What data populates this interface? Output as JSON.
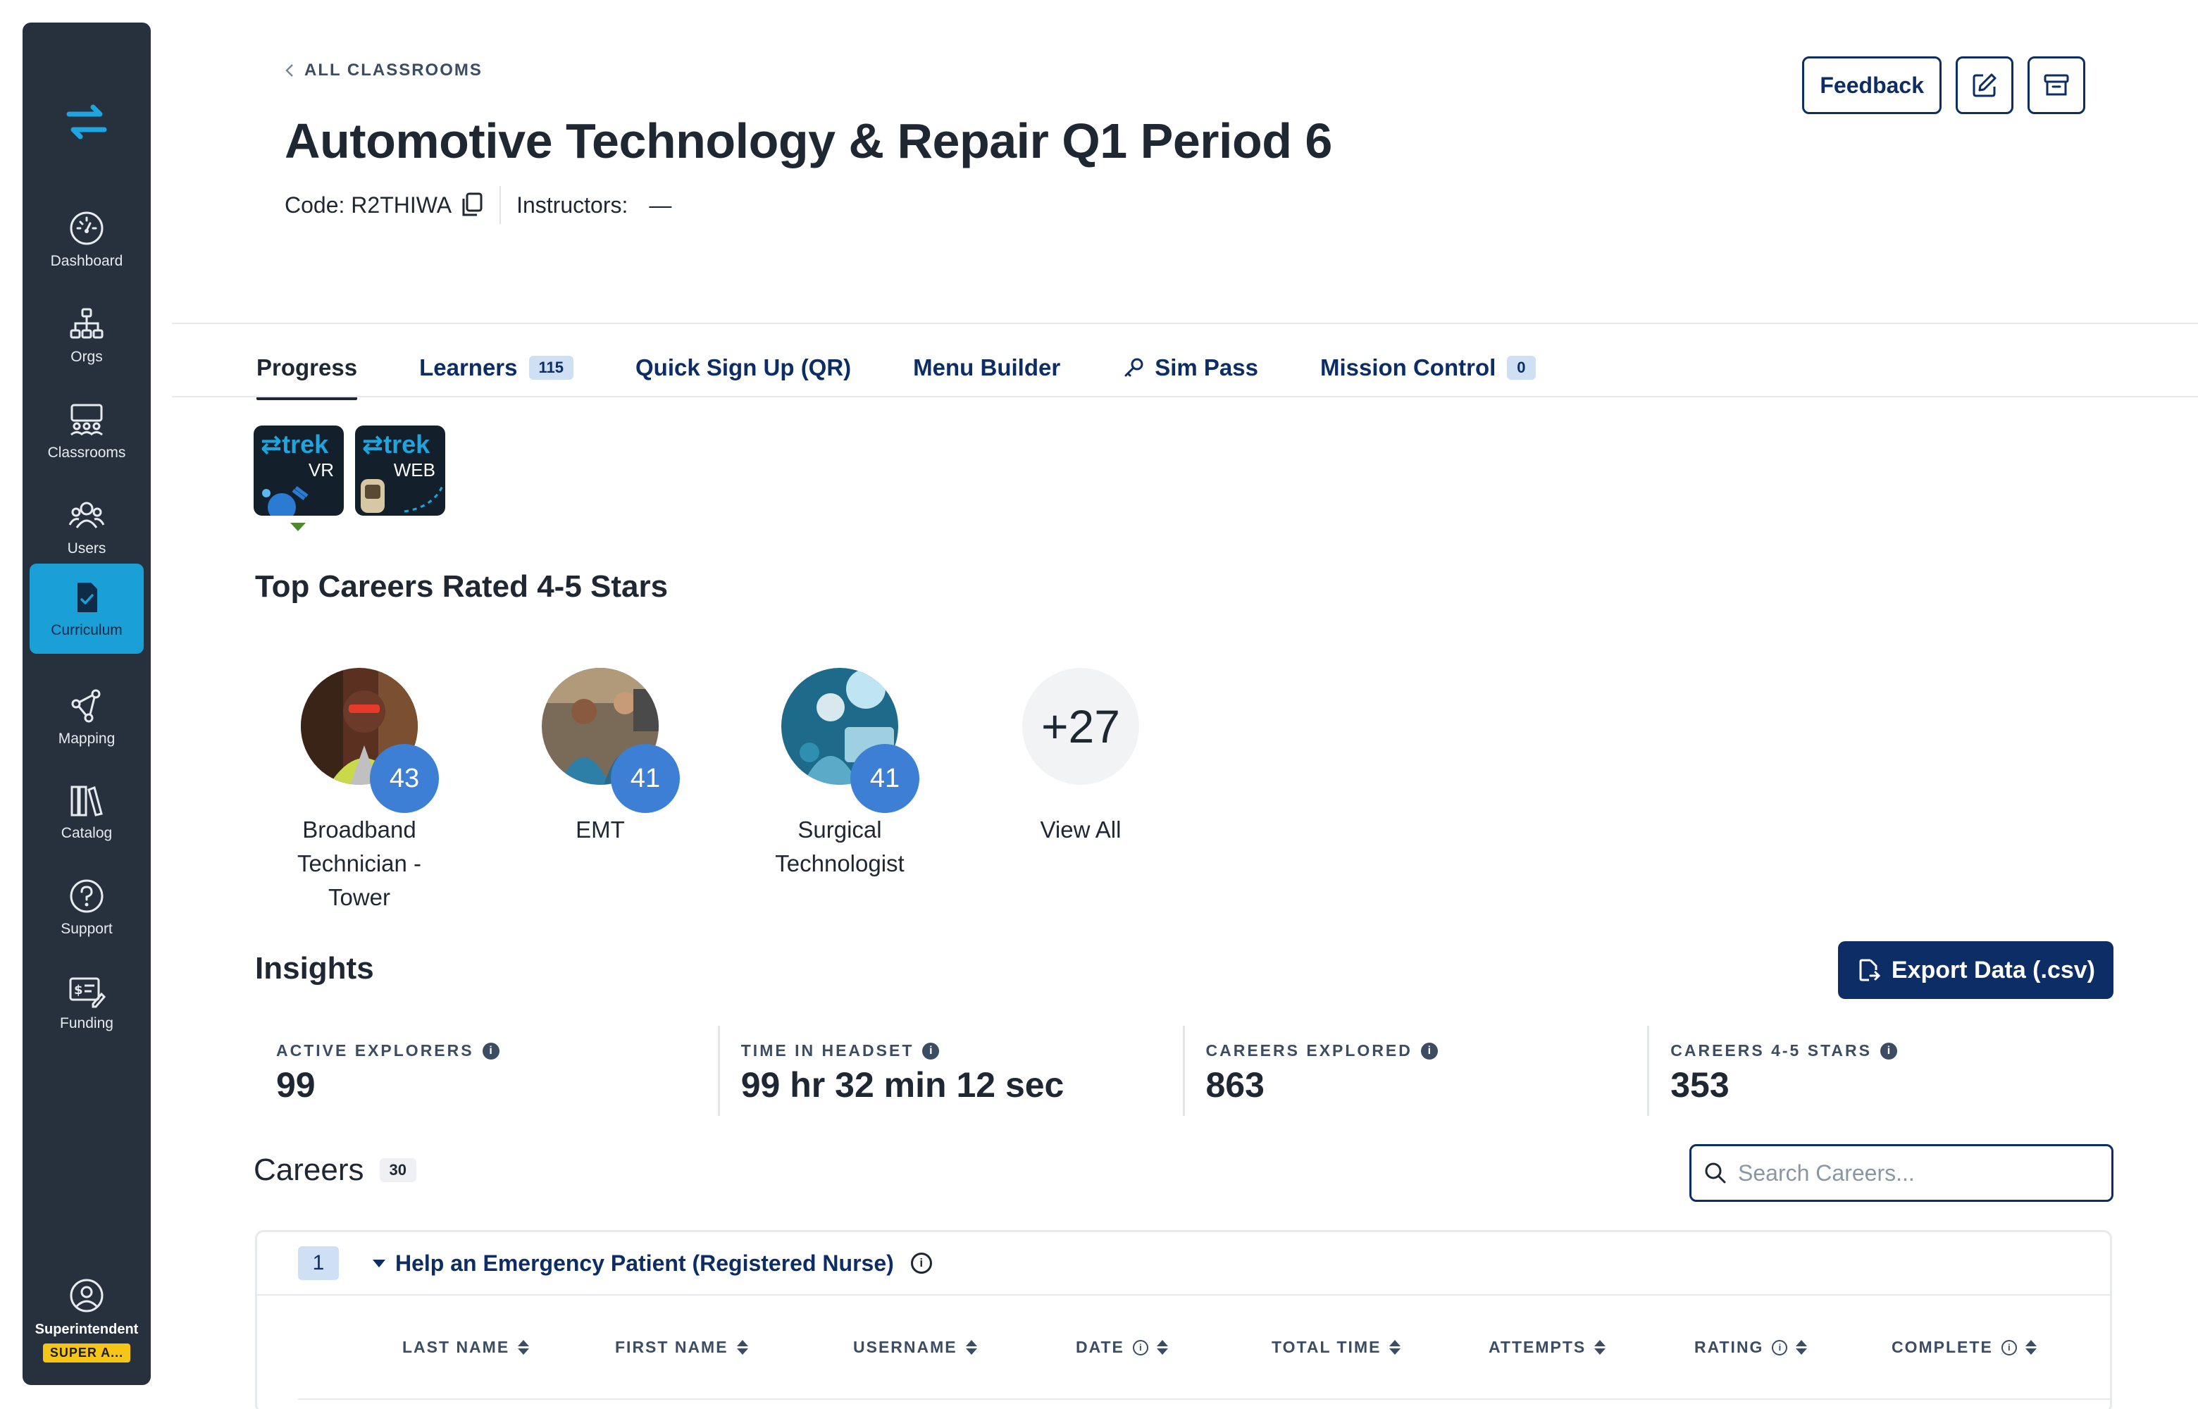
{
  "sidebar": {
    "items": [
      {
        "label": "Dashboard",
        "icon": "dashboard-gauge-icon"
      },
      {
        "label": "Orgs",
        "icon": "org-chart-icon"
      },
      {
        "label": "Classrooms",
        "icon": "classroom-icon"
      },
      {
        "label": "Users",
        "icon": "users-icon"
      },
      {
        "label": "Curriculum",
        "icon": "curriculum-document-icon",
        "active": true
      },
      {
        "label": "Mapping",
        "icon": "mapping-nodes-icon"
      },
      {
        "label": "Catalog",
        "icon": "catalog-books-icon"
      },
      {
        "label": "Support",
        "icon": "question-icon"
      },
      {
        "label": "Funding",
        "icon": "funding-icon"
      }
    ],
    "profile": {
      "label": "Superintendent",
      "badge": "SUPER A..."
    }
  },
  "header": {
    "back_label": "ALL CLASSROOMS",
    "title": "Automotive Technology & Repair Q1 Period 6",
    "code": "Code: R2THIWA",
    "instructors": "Instructors:",
    "instructors_value": "—",
    "feedback_label": "Feedback"
  },
  "tabs": [
    {
      "label": "Progress",
      "active": true
    },
    {
      "label": "Learners",
      "badge": "115"
    },
    {
      "label": "Quick Sign Up (QR)"
    },
    {
      "label": "Menu Builder"
    },
    {
      "label": "Sim Pass",
      "icon": "key-icon"
    },
    {
      "label": "Mission Control",
      "badge": "0"
    }
  ],
  "platforms": [
    {
      "brand": "⇄trek",
      "sub": "VR"
    },
    {
      "brand": "⇄trek",
      "sub": "WEB"
    }
  ],
  "top_careers": {
    "title": "Top Careers Rated 4-5 Stars",
    "items": [
      {
        "name": "Broadband Technician - Tower",
        "count": "43"
      },
      {
        "name": "EMT",
        "count": "41"
      },
      {
        "name": "Surgical Technologist",
        "count": "41"
      }
    ],
    "more": {
      "count": "+27",
      "label": "View All"
    }
  },
  "insights": {
    "title": "Insights",
    "export_label": "Export Data (.csv)",
    "stats": [
      {
        "label": "ACTIVE EXPLORERS",
        "value": "99"
      },
      {
        "label": "TIME IN HEADSET",
        "value": "99 hr 32 min 12 sec"
      },
      {
        "label": "CAREERS EXPLORED",
        "value": "863"
      },
      {
        "label": "CAREERS 4-5 STARS",
        "value": "353"
      }
    ]
  },
  "careers": {
    "title": "Careers",
    "count": "30",
    "search_placeholder": "Search Careers...",
    "rows": [
      {
        "num": "1",
        "title": "Help an Emergency Patient (Registered Nurse)"
      }
    ],
    "columns": [
      "LAST NAME",
      "FIRST NAME",
      "USERNAME",
      "DATE",
      "TOTAL TIME",
      "ATTEMPTS",
      "RATING",
      "COMPLETE"
    ]
  },
  "colors": {
    "sidebar_bg": "#27313d",
    "accent": "#1a9fd6",
    "navy": "#0d2d66",
    "badge_blue": "#3d7fd4",
    "caret_green": "#4f8a2e",
    "super_badge": "#f5c518"
  }
}
